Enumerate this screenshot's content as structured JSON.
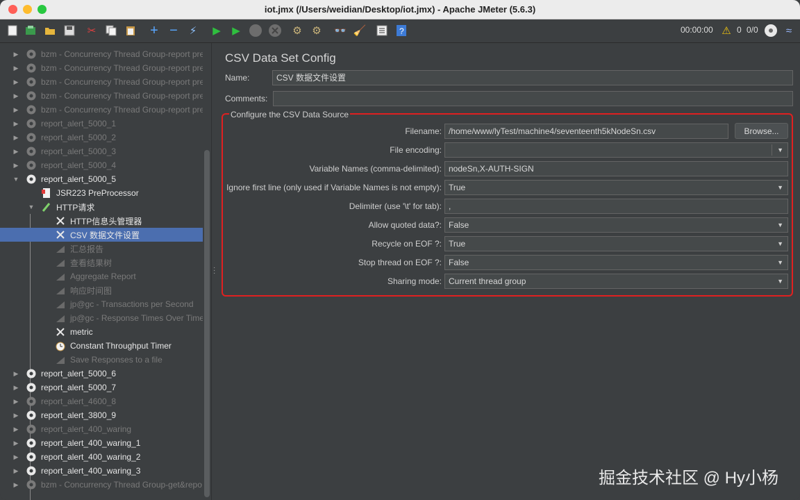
{
  "window": {
    "title": "iot.jmx (/Users/weidian/Desktop/iot.jmx) - Apache JMeter (5.6.3)"
  },
  "toolbar": {
    "timer": "00:00:00",
    "warnings": "0",
    "threads": "0/0"
  },
  "tree": {
    "items": [
      {
        "label": "bzm - Concurrency Thread Group-report pre",
        "state": "disabled",
        "icon": "gear-icon"
      },
      {
        "label": "bzm - Concurrency Thread Group-report pre",
        "state": "disabled",
        "icon": "gear-icon"
      },
      {
        "label": "bzm - Concurrency Thread Group-report pre",
        "state": "disabled",
        "icon": "gear-icon"
      },
      {
        "label": "bzm - Concurrency Thread Group-report pre",
        "state": "disabled",
        "icon": "gear-icon"
      },
      {
        "label": "bzm - Concurrency Thread Group-report pre",
        "state": "disabled",
        "icon": "gear-icon"
      },
      {
        "label": "report_alert_5000_1",
        "state": "disabled",
        "icon": "gear-icon"
      },
      {
        "label": "report_alert_5000_2",
        "state": "disabled",
        "icon": "gear-icon"
      },
      {
        "label": "report_alert_5000_3",
        "state": "disabled",
        "icon": "gear-icon"
      },
      {
        "label": "report_alert_5000_4",
        "state": "disabled",
        "icon": "gear-icon"
      },
      {
        "label": "report_alert_5000_5",
        "state": "enabled",
        "icon": "gear-icon"
      },
      {
        "label": "JSR223 PreProcessor",
        "state": "enabled",
        "icon": "script-icon"
      },
      {
        "label": "HTTP请求",
        "state": "enabled",
        "icon": "pipette-icon"
      },
      {
        "label": "HTTP信息头管理器",
        "state": "enabled",
        "icon": "wrench-icon"
      },
      {
        "label": "CSV 数据文件设置",
        "state": "selected",
        "icon": "wrench-icon"
      },
      {
        "label": "汇总报告",
        "state": "disabled",
        "icon": "graph-icon"
      },
      {
        "label": "查看结果树",
        "state": "disabled",
        "icon": "graph-icon"
      },
      {
        "label": "Aggregate Report",
        "state": "disabled",
        "icon": "graph-icon"
      },
      {
        "label": "响应时间图",
        "state": "disabled",
        "icon": "graph-icon"
      },
      {
        "label": "jp@gc - Transactions per Second",
        "state": "disabled",
        "icon": "graph-icon"
      },
      {
        "label": "jp@gc - Response Times Over Time",
        "state": "disabled",
        "icon": "graph-icon"
      },
      {
        "label": "metric",
        "state": "enabled",
        "icon": "wrench-icon"
      },
      {
        "label": "Constant Throughput Timer",
        "state": "enabled",
        "icon": "timer-icon"
      },
      {
        "label": "Save Responses to a file",
        "state": "disabled",
        "icon": "graph-icon"
      },
      {
        "label": "report_alert_5000_6",
        "state": "enabled",
        "icon": "gear-icon"
      },
      {
        "label": "report_alert_5000_7",
        "state": "enabled",
        "icon": "gear-icon"
      },
      {
        "label": "report_alert_4600_8",
        "state": "disabled",
        "icon": "gear-icon"
      },
      {
        "label": "report_alert_3800_9",
        "state": "enabled",
        "icon": "gear-icon"
      },
      {
        "label": "report_alert_400_waring",
        "state": "disabled",
        "icon": "gear-icon"
      },
      {
        "label": "report_alert_400_waring_1",
        "state": "enabled",
        "icon": "gear-icon"
      },
      {
        "label": "report_alert_400_waring_2",
        "state": "enabled",
        "icon": "gear-icon"
      },
      {
        "label": "report_alert_400_waring_3",
        "state": "enabled",
        "icon": "gear-icon"
      },
      {
        "label": "bzm - Concurrency Thread Group-get&repo",
        "state": "disabled",
        "icon": "gear-icon"
      }
    ]
  },
  "panel": {
    "title": "CSV Data Set Config",
    "name_label": "Name:",
    "name_value": "CSV 数据文件设置",
    "comments_label": "Comments:",
    "comments_value": "",
    "source_legend": "Configure the CSV Data Source",
    "filename_label": "Filename:",
    "filename_value": "/home/www/lyTest/machine4/seventeenth5kNodeSn.csv",
    "browse_label": "Browse...",
    "encoding_label": "File encoding:",
    "encoding_value": "",
    "varnames_label": "Variable Names (comma-delimited):",
    "varnames_value": "nodeSn,X-AUTH-SIGN",
    "ignore_label": "Ignore first line (only used if Variable Names is not empty):",
    "ignore_value": "True",
    "delimiter_label": "Delimiter (use '\\t' for tab):",
    "delimiter_value": ",",
    "quoted_label": "Allow quoted data?:",
    "quoted_value": "False",
    "recycle_label": "Recycle on EOF ?:",
    "recycle_value": "True",
    "stopthread_label": "Stop thread on EOF ?:",
    "stopthread_value": "False",
    "sharing_label": "Sharing mode:",
    "sharing_value": "Current thread group"
  },
  "watermark": "掘金技术社区 @ Hy小杨",
  "colors": {
    "highlight_border": "#e02020",
    "selection": "#4b6eaf",
    "background": "#3c3f41"
  }
}
